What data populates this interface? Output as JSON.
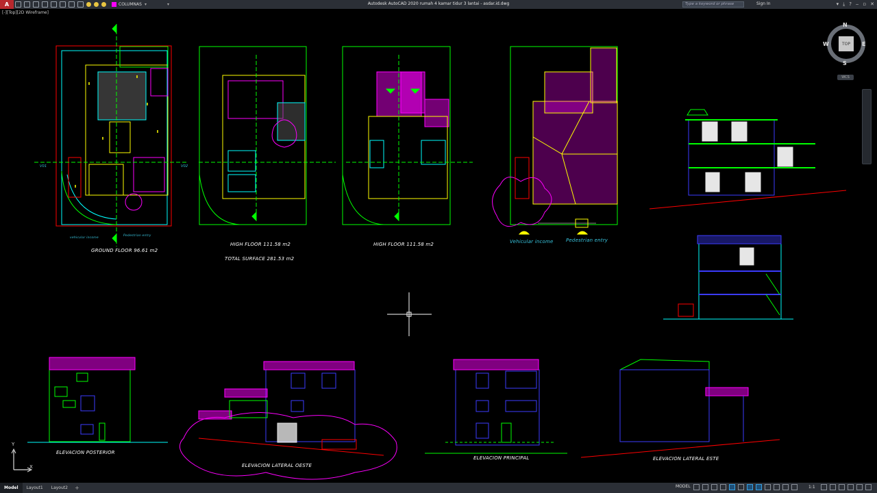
{
  "titlebar": {
    "app_button": "A",
    "layer_name": "COLUMNAS",
    "app_title": "Autodesk AutoCAD 2020   rumah 4 kamar tidur 3 lantai - asdar.id.dwg",
    "search_placeholder": "Type a keyword or phrase",
    "sign_in": "Sign In"
  },
  "viewport": {
    "label": "[-][Top][2D Wireframe]"
  },
  "viewcube": {
    "top": "TOP",
    "north": "N",
    "south": "S",
    "east": "E",
    "west": "W",
    "wcs": "WCS"
  },
  "labels": {
    "ground_floor": "GROUND FLOOR 96.61 m2",
    "high_floor_1": "HIGH FLOOR 111.58 m2",
    "high_floor_2": "HIGH FLOOR 111.58 m2",
    "total_surface": "TOTAL SURFACE 281.53 m2",
    "vehicular_income": "Vehicular income",
    "pedestrian_entry": "Pedestrian entry",
    "elev_posterior": "ELEVACION POSTERIOR",
    "elev_oeste": "ELEVACION LATERAL OESTE",
    "elev_principal": "ELEVACION PRINCIPAL",
    "elev_este": "ELEVACION LATERAL ESTE",
    "v01_left": "V01",
    "v02_right": "V02",
    "vehicular_small": "vehicular income",
    "pedestrian_small": "Pedestrian entry"
  },
  "ucs": {
    "x": "X",
    "y": "Y"
  },
  "statusbar": {
    "tabs": [
      "Model",
      "Layout1",
      "Layout2"
    ],
    "active_tab": "Model",
    "model_button": "MODEL",
    "scale": "1:1"
  },
  "colors": {
    "accent_magenta": "#ff00ff",
    "line_green": "#00ff00",
    "line_yellow": "#ffff00",
    "line_cyan": "#00ffff",
    "line_blue": "#3b3bff",
    "line_red": "#ff0000"
  }
}
